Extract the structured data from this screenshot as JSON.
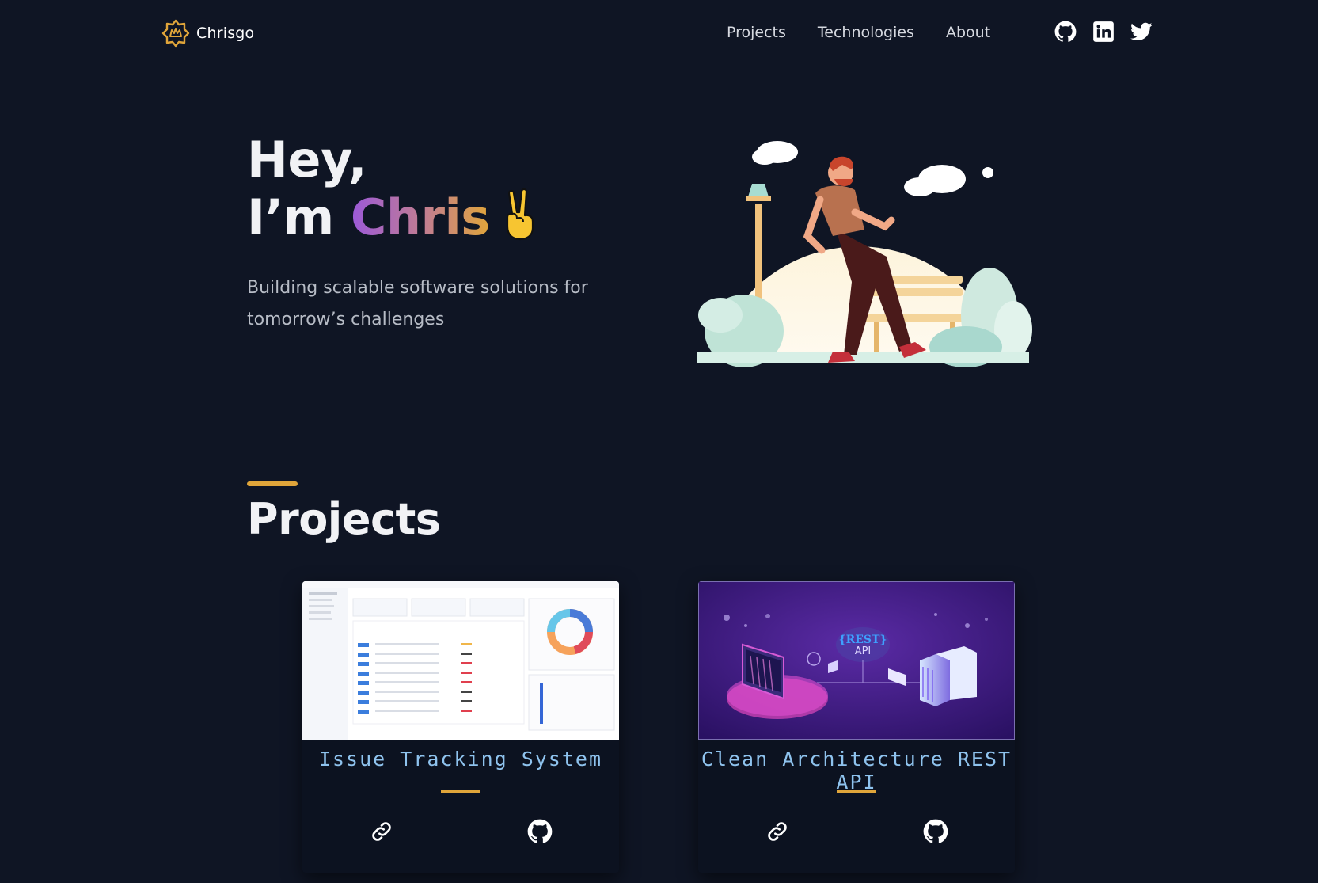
{
  "nav": {
    "brand": "Chrisgo",
    "links": [
      "Projects",
      "Technologies",
      "About"
    ],
    "socials": [
      "github-icon",
      "linkedin-icon",
      "twitter-icon"
    ]
  },
  "hero": {
    "greeting": "Hey,",
    "im": "I’m",
    "name": "Chris",
    "emoji": "victory-hand-icon",
    "subtitle": "Building scalable software solutions for tomorrow’s challenges"
  },
  "projects": {
    "title": "Projects",
    "items": [
      {
        "title": "Issue Tracking System",
        "live_icon": "link-icon",
        "repo_icon": "github-icon"
      },
      {
        "title": "Clean Architecture REST API",
        "live_icon": "link-icon",
        "repo_icon": "github-icon"
      }
    ],
    "thumb_texts": {
      "rest_badge": "{REST}",
      "api_label": "API"
    }
  },
  "colors": {
    "background": "#0f1524",
    "accent": "#e0a53a",
    "card_title": "#8fc3ee",
    "gradient_start": "#9b59d9",
    "gradient_end": "#e0a53a"
  }
}
